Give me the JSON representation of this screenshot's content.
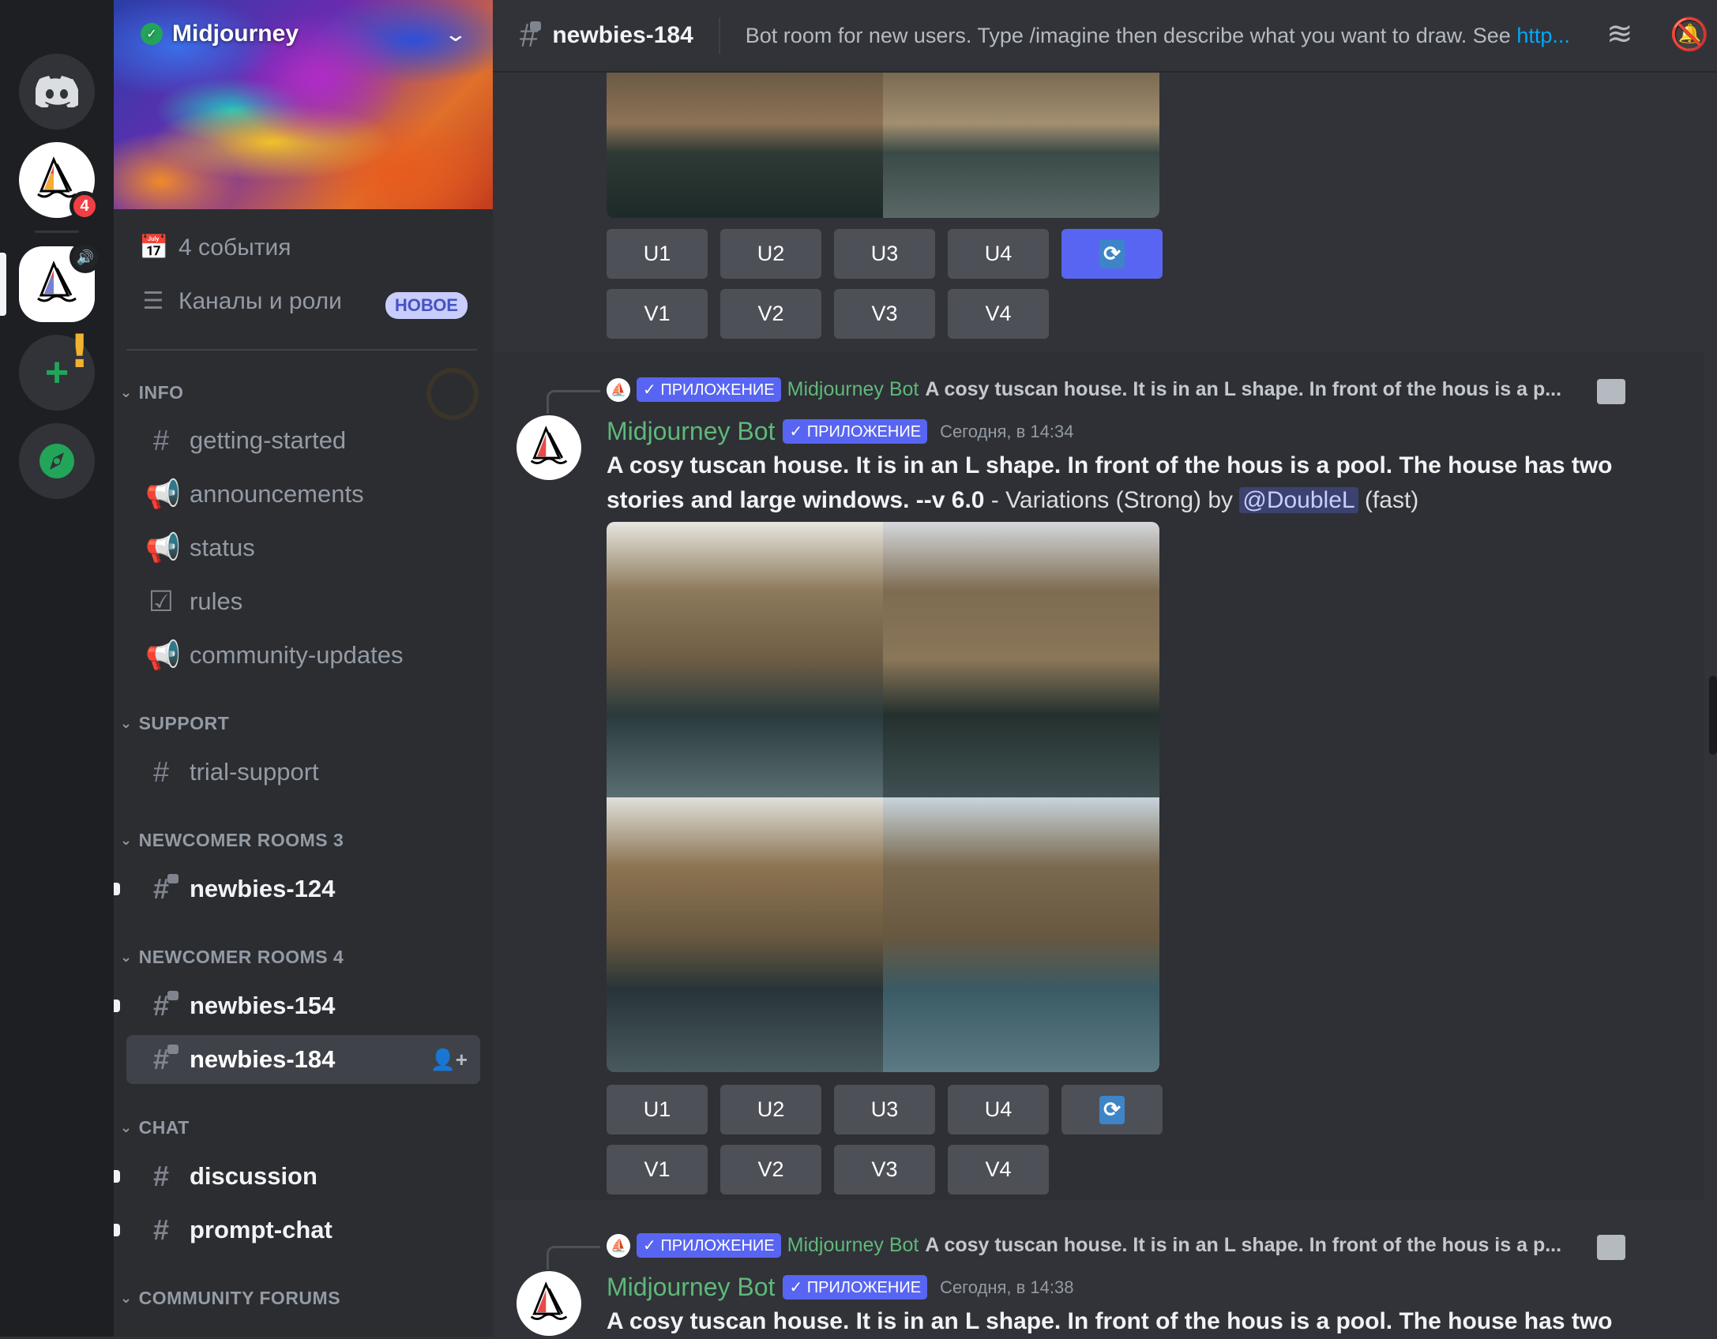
{
  "rail": {
    "home_icon": "discord-logo-icon",
    "server1_badge": "4",
    "server2_status": "speaker-icon",
    "add_server": "+",
    "explore": "compass-icon"
  },
  "server": {
    "name": "Midjourney",
    "verified": "✓",
    "chevron": "⌄"
  },
  "sidebar": {
    "events": "4 события",
    "channels_roles": "Каналы и роли",
    "new_badge": "НОВОЕ",
    "categories": [
      {
        "name": "INFO",
        "channels": [
          "getting-started",
          "announcements",
          "status",
          "rules",
          "community-updates"
        ]
      },
      {
        "name": "SUPPORT",
        "channels": [
          "trial-support"
        ]
      },
      {
        "name": "NEWCOMER ROOMS 3",
        "channels": [
          "newbies-124"
        ]
      },
      {
        "name": "NEWCOMER ROOMS 4",
        "channels": [
          "newbies-154",
          "newbies-184"
        ]
      },
      {
        "name": "CHAT",
        "channels": [
          "discussion",
          "prompt-chat"
        ]
      },
      {
        "name": "COMMUNITY FORUMS",
        "channels": []
      }
    ]
  },
  "header": {
    "channel": "newbies-184",
    "topic": "Bot room for new users. Type /imagine then describe what you want to draw. See ",
    "topic_link": "http..."
  },
  "buttons": {
    "upscale": [
      "U1",
      "U2",
      "U3",
      "U4"
    ],
    "variation": [
      "V1",
      "V2",
      "V3",
      "V4"
    ],
    "reroll": "🔄"
  },
  "messages": [
    {
      "reply_tag": "✓ ПРИЛОЖЕНИЕ",
      "reply_author": "Midjourney Bot",
      "reply_text": "A cosy tuscan house. It is in an L shape. In front of the hous is a p...",
      "author": "Midjourney Bot",
      "tag": "✓ ПРИЛОЖЕНИЕ",
      "timestamp": "Сегодня, в 14:34",
      "prompt": "A cosy tuscan house. It is in an L shape. In front of the hous is a pool. The house has two stories and large windows. --v 6.0",
      "suffix_pre": " - Variations (Strong) by ",
      "mention": "@DoubleL",
      "suffix_post": " (fast)"
    },
    {
      "reply_tag": "✓ ПРИЛОЖЕНИЕ",
      "reply_author": "Midjourney Bot",
      "reply_text": "A cosy tuscan house. It is in an L shape. In front of the hous is a p...",
      "author": "Midjourney Bot",
      "tag": "✓ ПРИЛОЖЕНИЕ",
      "timestamp": "Сегодня, в 14:38",
      "prompt": "A cosy tuscan house. It is in an L shape. In front of the hous is a pool. The house has two"
    }
  ]
}
